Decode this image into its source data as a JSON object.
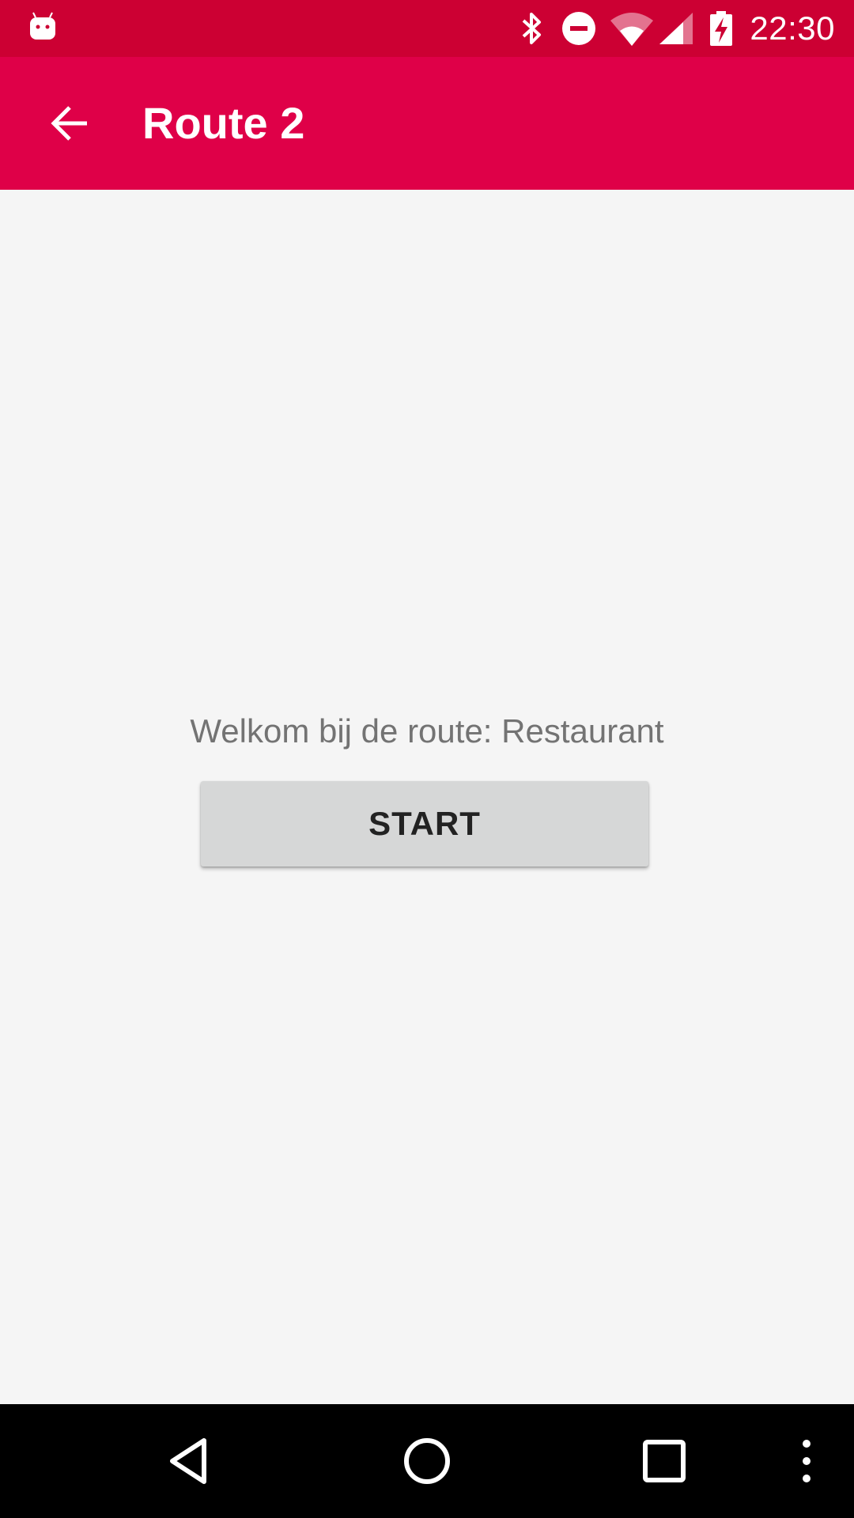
{
  "status_bar": {
    "time": "22:30",
    "icons": [
      "android-debug-icon",
      "bluetooth-icon",
      "do-not-disturb-icon",
      "wifi-icon",
      "cell-signal-icon",
      "battery-charging-icon"
    ],
    "background_color": "#cc0033"
  },
  "app_bar": {
    "title": "Route 2",
    "back_icon": "arrow-back-icon",
    "background_color": "#df0048"
  },
  "main": {
    "welcome_text": "Welkom bij de route: Restaurant",
    "start_button_label": "START"
  },
  "nav_bar": {
    "buttons": [
      "back-triangle-icon",
      "home-circle-icon",
      "recents-square-icon",
      "overflow-menu-icon"
    ]
  }
}
